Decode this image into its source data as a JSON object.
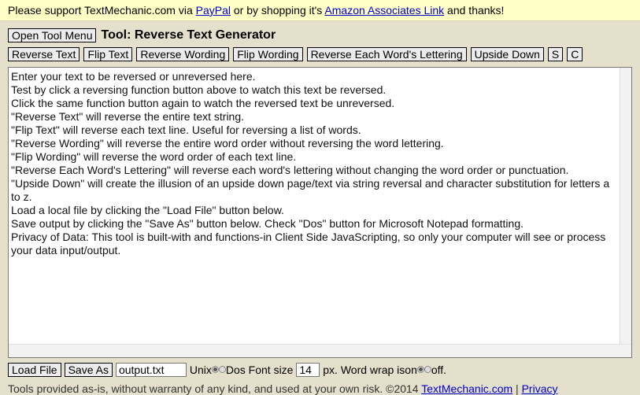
{
  "banner": {
    "prefix": "Please support TextMechanic.com via ",
    "paypal_link": "PayPal",
    "middle": " or by shopping it's ",
    "amazon_link": "Amazon Associates Link",
    "suffix": " and thanks!"
  },
  "header": {
    "open_menu_label": "Open Tool Menu",
    "tool_title": "Tool: Reverse Text Generator"
  },
  "toolbar": {
    "reverse_text": "Reverse Text",
    "flip_text": "Flip Text",
    "reverse_wording": "Reverse Wording",
    "flip_wording": "Flip Wording",
    "reverse_each_word": "Reverse Each Word's Lettering",
    "upside_down": "Upside Down",
    "s": "S",
    "c": "C"
  },
  "editor": {
    "lines": [
      "Enter your text to be reversed or unreversed here.",
      "Test by click a reversing function button above to watch this text be reversed.",
      "Click the same function button again to watch the reversed text be unreversed.",
      "\"Reverse Text\" will reverse the entire text string.",
      "\"Flip Text\" will reverse each text line. Useful for reversing a list of words.",
      "\"Reverse Wording\" will reverse the entire word order without reversing the word lettering.",
      "\"Flip Wording\" will reverse the word order of each text line.",
      "\"Reverse Each Word's Lettering\" will reverse each word's lettering without changing the word order or punctuation.",
      "\"Upside Down\" will create the illusion of an upside down page/text via string reversal and character substitution for letters a to z.",
      "Load a local file by clicking the \"Load File\" button below.",
      "Save output by clicking the \"Save As\" button below. Check \"Dos\" button for Microsoft Notepad formatting.",
      "Privacy of Data: This tool is built-with and functions-in Client Side JavaScripting, so only your computer will see or process your data input/output."
    ]
  },
  "bottom": {
    "load_file": "Load File",
    "save_as": "Save As",
    "filename": "output.txt",
    "unix_label": "Unix",
    "dos_label": "Dos",
    "font_size_label": "Font size",
    "font_size_value": "14",
    "px_label": "px.",
    "word_wrap_label": "Word wrap is",
    "on_label": "on",
    "off_label": "off."
  },
  "footer": {
    "text": "Tools provided as-is, without warranty of any kind, and used at your own risk. ©2014 ",
    "site_link": "TextMechanic.com",
    "separator": " | ",
    "privacy_link": "Privacy"
  }
}
